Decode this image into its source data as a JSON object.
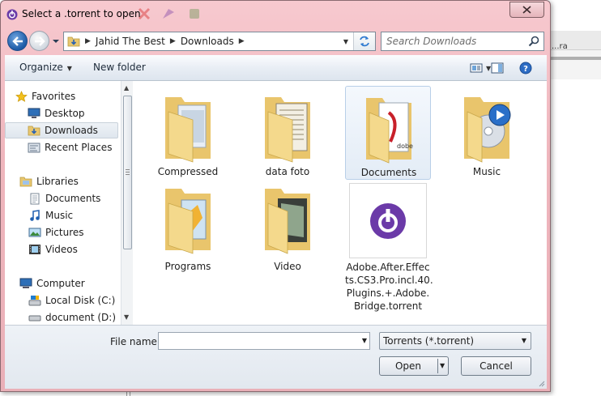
{
  "window": {
    "title": "Select a .torrent to open",
    "accent_color": "#efb6bd",
    "close_icon": "close-icon"
  },
  "background_app": {
    "snippet": "...ra"
  },
  "address_bar": {
    "breadcrumbs": [
      "Jahid The Best",
      "Downloads"
    ]
  },
  "search": {
    "placeholder": "Search Downloads"
  },
  "toolbar": {
    "organize_label": "Organize",
    "new_folder_label": "New folder"
  },
  "nav": {
    "favorites_label": "Favorites",
    "favorites": [
      {
        "label": "Desktop",
        "icon": "desktop-icon"
      },
      {
        "label": "Downloads",
        "icon": "downloads-folder-icon",
        "selected": true
      },
      {
        "label": "Recent Places",
        "icon": "recent-places-icon"
      }
    ],
    "libraries_label": "Libraries",
    "libraries": [
      {
        "label": "Documents",
        "icon": "documents-library-icon"
      },
      {
        "label": "Music",
        "icon": "music-library-icon"
      },
      {
        "label": "Pictures",
        "icon": "pictures-library-icon"
      },
      {
        "label": "Videos",
        "icon": "videos-library-icon"
      }
    ],
    "computer_label": "Computer",
    "computer": [
      {
        "label": "Local Disk (C:)",
        "icon": "local-disk-icon"
      },
      {
        "label": "document (D:)",
        "icon": "drive-icon"
      }
    ]
  },
  "files": [
    {
      "label": "Compressed",
      "icon": "folder-icon"
    },
    {
      "label": "data foto",
      "icon": "folder-icon"
    },
    {
      "label": "Documents",
      "icon": "folder-icon",
      "selected": true
    },
    {
      "label": "Music",
      "icon": "folder-icon"
    },
    {
      "label": "Programs",
      "icon": "folder-icon"
    },
    {
      "label": "Video",
      "icon": "folder-icon"
    }
  ],
  "torrent_file": {
    "label_lines": [
      "Adobe.After.Effec",
      "ts.CS3.Pro.incl.40.",
      "Plugins.+.Adobe.",
      "Bridge.torrent"
    ],
    "icon": "bittorrent-icon"
  },
  "footer": {
    "file_name_label": "File name:",
    "file_name_value": "",
    "file_type_value": "Torrents (*.torrent)",
    "open_label": "Open",
    "cancel_label": "Cancel"
  }
}
